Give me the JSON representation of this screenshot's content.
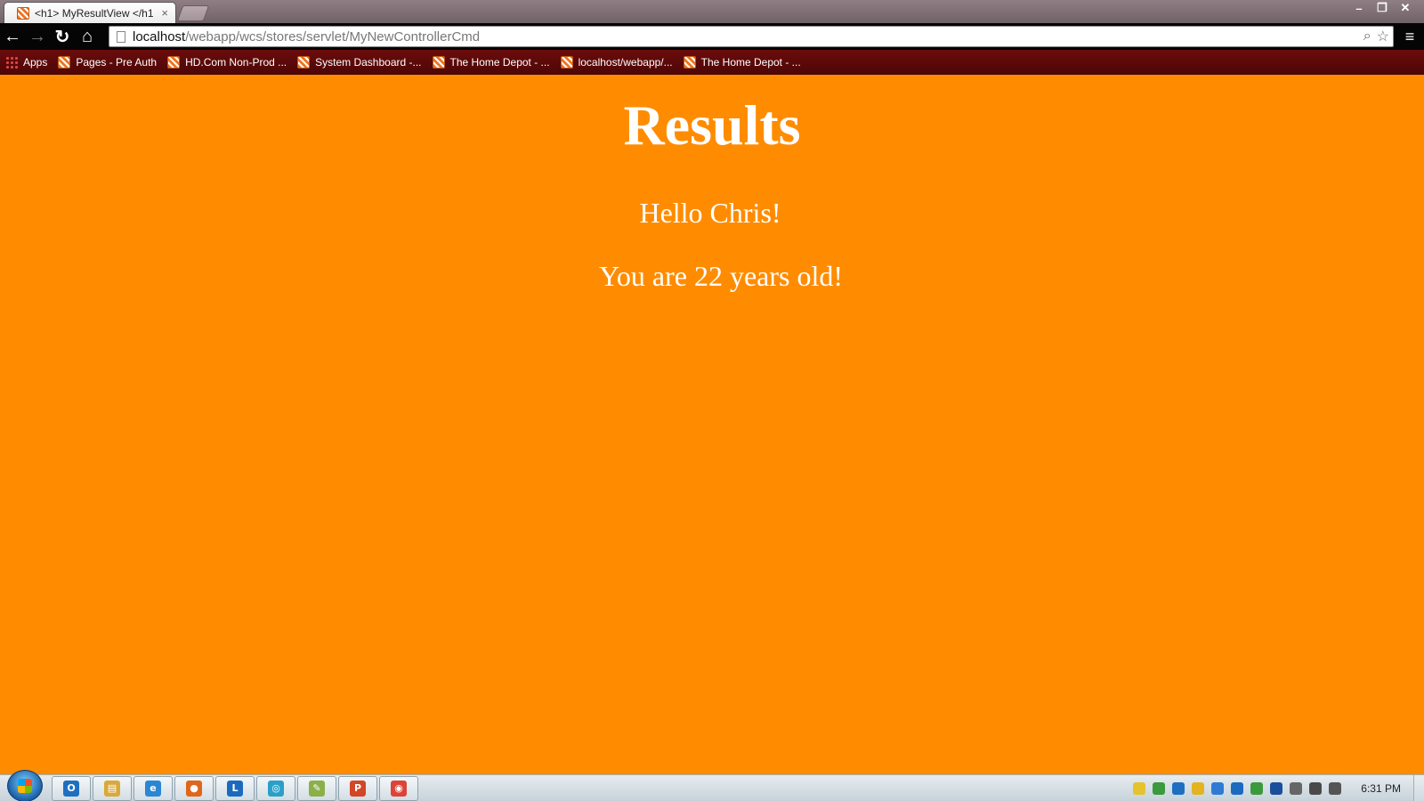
{
  "browser": {
    "tab": {
      "title": "<h1> MyResultView </h1",
      "close": "×"
    },
    "window_controls": {
      "minimize": "–",
      "restore": "❐",
      "close": "✕"
    },
    "nav": {
      "back": "←",
      "forward": "→",
      "reload": "↻",
      "home": "⌂"
    },
    "address": {
      "host": "localhost",
      "path": "/webapp/wcs/stores/servlet/MyNewControllerCmd"
    },
    "omnibox_icons": {
      "zoom": "⌕",
      "star": "☆"
    },
    "menu": "≡",
    "bookmarks": [
      {
        "label": "Apps",
        "icon": "apps-grid-icon"
      },
      {
        "label": "Pages - Pre Auth",
        "icon": "home-depot-favicon"
      },
      {
        "label": "HD.Com Non-Prod ...",
        "icon": "home-depot-favicon"
      },
      {
        "label": "System Dashboard -...",
        "icon": "home-depot-favicon"
      },
      {
        "label": "The Home Depot - ...",
        "icon": "home-depot-favicon"
      },
      {
        "label": "localhost/webapp/...",
        "icon": "home-depot-favicon"
      },
      {
        "label": "The Home Depot - ...",
        "icon": "home-depot-favicon"
      }
    ]
  },
  "page": {
    "heading": "Results",
    "greeting": "Hello Chris!",
    "age_message": "You are 22 years old!",
    "background_color": "#ff8c00",
    "text_color": "#ffffff"
  },
  "taskbar": {
    "pinned": [
      {
        "name": "outlook",
        "glyph": "O",
        "color": "#1f6fc1"
      },
      {
        "name": "explorer",
        "glyph": "▤",
        "color": "#d9a93a"
      },
      {
        "name": "internet-explorer",
        "glyph": "e",
        "color": "#2b86d4"
      },
      {
        "name": "firefox",
        "glyph": "●",
        "color": "#e0661b"
      },
      {
        "name": "lync",
        "glyph": "L",
        "color": "#1b6ac0"
      },
      {
        "name": "app-circle",
        "glyph": "◎",
        "color": "#2aa0c8"
      },
      {
        "name": "notepad",
        "glyph": "✎",
        "color": "#8bb04a"
      },
      {
        "name": "powerpoint",
        "glyph": "P",
        "color": "#d24726"
      },
      {
        "name": "chrome",
        "glyph": "◉",
        "color": "#db4437"
      }
    ],
    "tray_colors": [
      "#e5c32f",
      "#3b9a3b",
      "#1f6fc1",
      "#e3b320",
      "#2e7bd6",
      "#1b6ac0",
      "#3b9a3b",
      "#1b4f9c",
      "#666666",
      "#4a4a4a",
      "#555555"
    ],
    "clock": "6:31 PM"
  }
}
